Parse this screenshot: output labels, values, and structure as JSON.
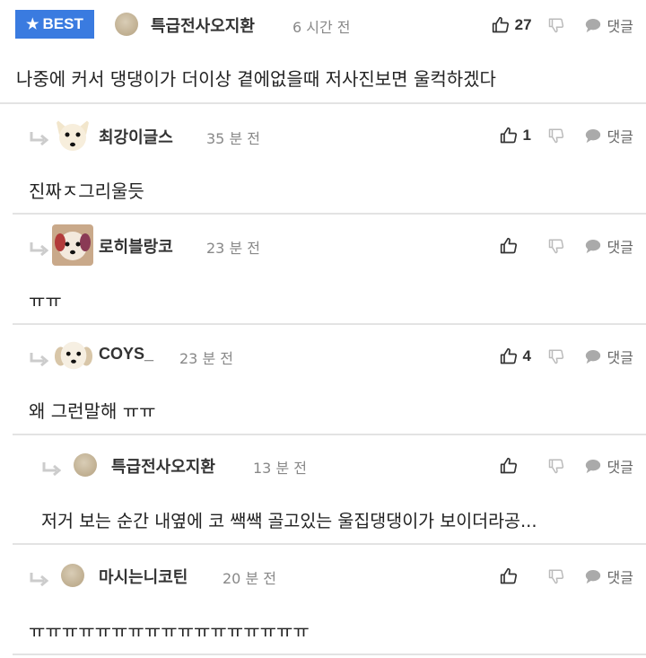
{
  "comments": [
    {
      "best_label": "BEST",
      "username": "특급전사오지환",
      "time": "6 시간 전",
      "likes": "27",
      "reply_label": "댓글",
      "text": "나중에 커서 댕댕이가 더이상 곁에없을때 저사진보면 울컥하겠다",
      "avatar": "blank-avatar"
    },
    {
      "username": "최강이글스",
      "time": "35 분 전",
      "likes": "1",
      "reply_label": "댓글",
      "text": "진짜ㅈ그리울듯",
      "avatar": "dog-avatar"
    },
    {
      "username": "로히블랑코",
      "time": "23 분 전",
      "likes": "",
      "reply_label": "댓글",
      "text": "ㅠㅠ",
      "avatar": "dog-avatar"
    },
    {
      "username": "COYS_",
      "time": "23 분 전",
      "likes": "4",
      "reply_label": "댓글",
      "text": "왜 그런말해 ㅠㅠ",
      "avatar": "dog-avatar"
    },
    {
      "username": "특급전사오지환",
      "time": "13 분 전",
      "likes": "",
      "reply_label": "댓글",
      "text": "저거 보는 순간 내옆에 코 쌕쌕 골고있는 울집댕댕이가 보이더라공...",
      "avatar": "blank-avatar"
    },
    {
      "username": "마시는니코틴",
      "time": "20 분 전",
      "likes": "",
      "reply_label": "댓글",
      "text": "ㅠㅠㅠㅠㅠㅠㅠㅠㅠㅠㅠㅠㅠㅠㅠㅠㅠ",
      "avatar": "blank-avatar"
    }
  ],
  "colors": {
    "best_badge": "#3a7be0",
    "divider": "#e3e3e3",
    "muted_text": "#888888"
  }
}
